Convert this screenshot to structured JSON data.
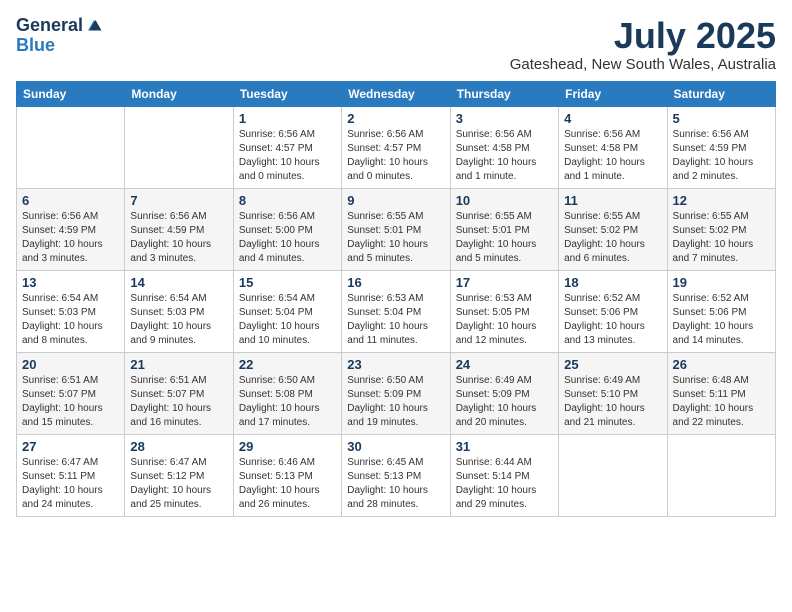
{
  "logo": {
    "line1": "General",
    "line2": "Blue"
  },
  "title": "July 2025",
  "location": "Gateshead, New South Wales, Australia",
  "weekdays": [
    "Sunday",
    "Monday",
    "Tuesday",
    "Wednesday",
    "Thursday",
    "Friday",
    "Saturday"
  ],
  "weeks": [
    [
      {
        "day": "",
        "info": ""
      },
      {
        "day": "",
        "info": ""
      },
      {
        "day": "1",
        "info": "Sunrise: 6:56 AM\nSunset: 4:57 PM\nDaylight: 10 hours\nand 0 minutes."
      },
      {
        "day": "2",
        "info": "Sunrise: 6:56 AM\nSunset: 4:57 PM\nDaylight: 10 hours\nand 0 minutes."
      },
      {
        "day": "3",
        "info": "Sunrise: 6:56 AM\nSunset: 4:58 PM\nDaylight: 10 hours\nand 1 minute."
      },
      {
        "day": "4",
        "info": "Sunrise: 6:56 AM\nSunset: 4:58 PM\nDaylight: 10 hours\nand 1 minute."
      },
      {
        "day": "5",
        "info": "Sunrise: 6:56 AM\nSunset: 4:59 PM\nDaylight: 10 hours\nand 2 minutes."
      }
    ],
    [
      {
        "day": "6",
        "info": "Sunrise: 6:56 AM\nSunset: 4:59 PM\nDaylight: 10 hours\nand 3 minutes."
      },
      {
        "day": "7",
        "info": "Sunrise: 6:56 AM\nSunset: 4:59 PM\nDaylight: 10 hours\nand 3 minutes."
      },
      {
        "day": "8",
        "info": "Sunrise: 6:56 AM\nSunset: 5:00 PM\nDaylight: 10 hours\nand 4 minutes."
      },
      {
        "day": "9",
        "info": "Sunrise: 6:55 AM\nSunset: 5:01 PM\nDaylight: 10 hours\nand 5 minutes."
      },
      {
        "day": "10",
        "info": "Sunrise: 6:55 AM\nSunset: 5:01 PM\nDaylight: 10 hours\nand 5 minutes."
      },
      {
        "day": "11",
        "info": "Sunrise: 6:55 AM\nSunset: 5:02 PM\nDaylight: 10 hours\nand 6 minutes."
      },
      {
        "day": "12",
        "info": "Sunrise: 6:55 AM\nSunset: 5:02 PM\nDaylight: 10 hours\nand 7 minutes."
      }
    ],
    [
      {
        "day": "13",
        "info": "Sunrise: 6:54 AM\nSunset: 5:03 PM\nDaylight: 10 hours\nand 8 minutes."
      },
      {
        "day": "14",
        "info": "Sunrise: 6:54 AM\nSunset: 5:03 PM\nDaylight: 10 hours\nand 9 minutes."
      },
      {
        "day": "15",
        "info": "Sunrise: 6:54 AM\nSunset: 5:04 PM\nDaylight: 10 hours\nand 10 minutes."
      },
      {
        "day": "16",
        "info": "Sunrise: 6:53 AM\nSunset: 5:04 PM\nDaylight: 10 hours\nand 11 minutes."
      },
      {
        "day": "17",
        "info": "Sunrise: 6:53 AM\nSunset: 5:05 PM\nDaylight: 10 hours\nand 12 minutes."
      },
      {
        "day": "18",
        "info": "Sunrise: 6:52 AM\nSunset: 5:06 PM\nDaylight: 10 hours\nand 13 minutes."
      },
      {
        "day": "19",
        "info": "Sunrise: 6:52 AM\nSunset: 5:06 PM\nDaylight: 10 hours\nand 14 minutes."
      }
    ],
    [
      {
        "day": "20",
        "info": "Sunrise: 6:51 AM\nSunset: 5:07 PM\nDaylight: 10 hours\nand 15 minutes."
      },
      {
        "day": "21",
        "info": "Sunrise: 6:51 AM\nSunset: 5:07 PM\nDaylight: 10 hours\nand 16 minutes."
      },
      {
        "day": "22",
        "info": "Sunrise: 6:50 AM\nSunset: 5:08 PM\nDaylight: 10 hours\nand 17 minutes."
      },
      {
        "day": "23",
        "info": "Sunrise: 6:50 AM\nSunset: 5:09 PM\nDaylight: 10 hours\nand 19 minutes."
      },
      {
        "day": "24",
        "info": "Sunrise: 6:49 AM\nSunset: 5:09 PM\nDaylight: 10 hours\nand 20 minutes."
      },
      {
        "day": "25",
        "info": "Sunrise: 6:49 AM\nSunset: 5:10 PM\nDaylight: 10 hours\nand 21 minutes."
      },
      {
        "day": "26",
        "info": "Sunrise: 6:48 AM\nSunset: 5:11 PM\nDaylight: 10 hours\nand 22 minutes."
      }
    ],
    [
      {
        "day": "27",
        "info": "Sunrise: 6:47 AM\nSunset: 5:11 PM\nDaylight: 10 hours\nand 24 minutes."
      },
      {
        "day": "28",
        "info": "Sunrise: 6:47 AM\nSunset: 5:12 PM\nDaylight: 10 hours\nand 25 minutes."
      },
      {
        "day": "29",
        "info": "Sunrise: 6:46 AM\nSunset: 5:13 PM\nDaylight: 10 hours\nand 26 minutes."
      },
      {
        "day": "30",
        "info": "Sunrise: 6:45 AM\nSunset: 5:13 PM\nDaylight: 10 hours\nand 28 minutes."
      },
      {
        "day": "31",
        "info": "Sunrise: 6:44 AM\nSunset: 5:14 PM\nDaylight: 10 hours\nand 29 minutes."
      },
      {
        "day": "",
        "info": ""
      },
      {
        "day": "",
        "info": ""
      }
    ]
  ]
}
